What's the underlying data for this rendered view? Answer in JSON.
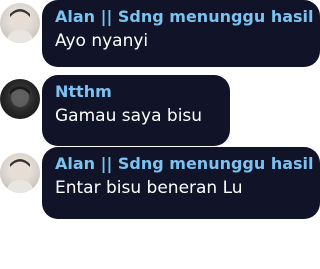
{
  "colors": {
    "bubble_bg": "#111428",
    "sender_name": "#7cc2f1",
    "message_text": "#ffffff",
    "page_bg": "#ffffff"
  },
  "messages": [
    {
      "sender": "Alan || Sdng menunggu hasil",
      "text": "Ayo nyanyi",
      "avatar_icon": "profile-photo-light"
    },
    {
      "sender": "Ntthm",
      "text": "Gamau saya bisu",
      "avatar_icon": "profile-photo-dark"
    },
    {
      "sender": "Alan || Sdng menunggu hasil",
      "text": "Entar bisu beneran Lu",
      "avatar_icon": "profile-photo-light"
    }
  ]
}
